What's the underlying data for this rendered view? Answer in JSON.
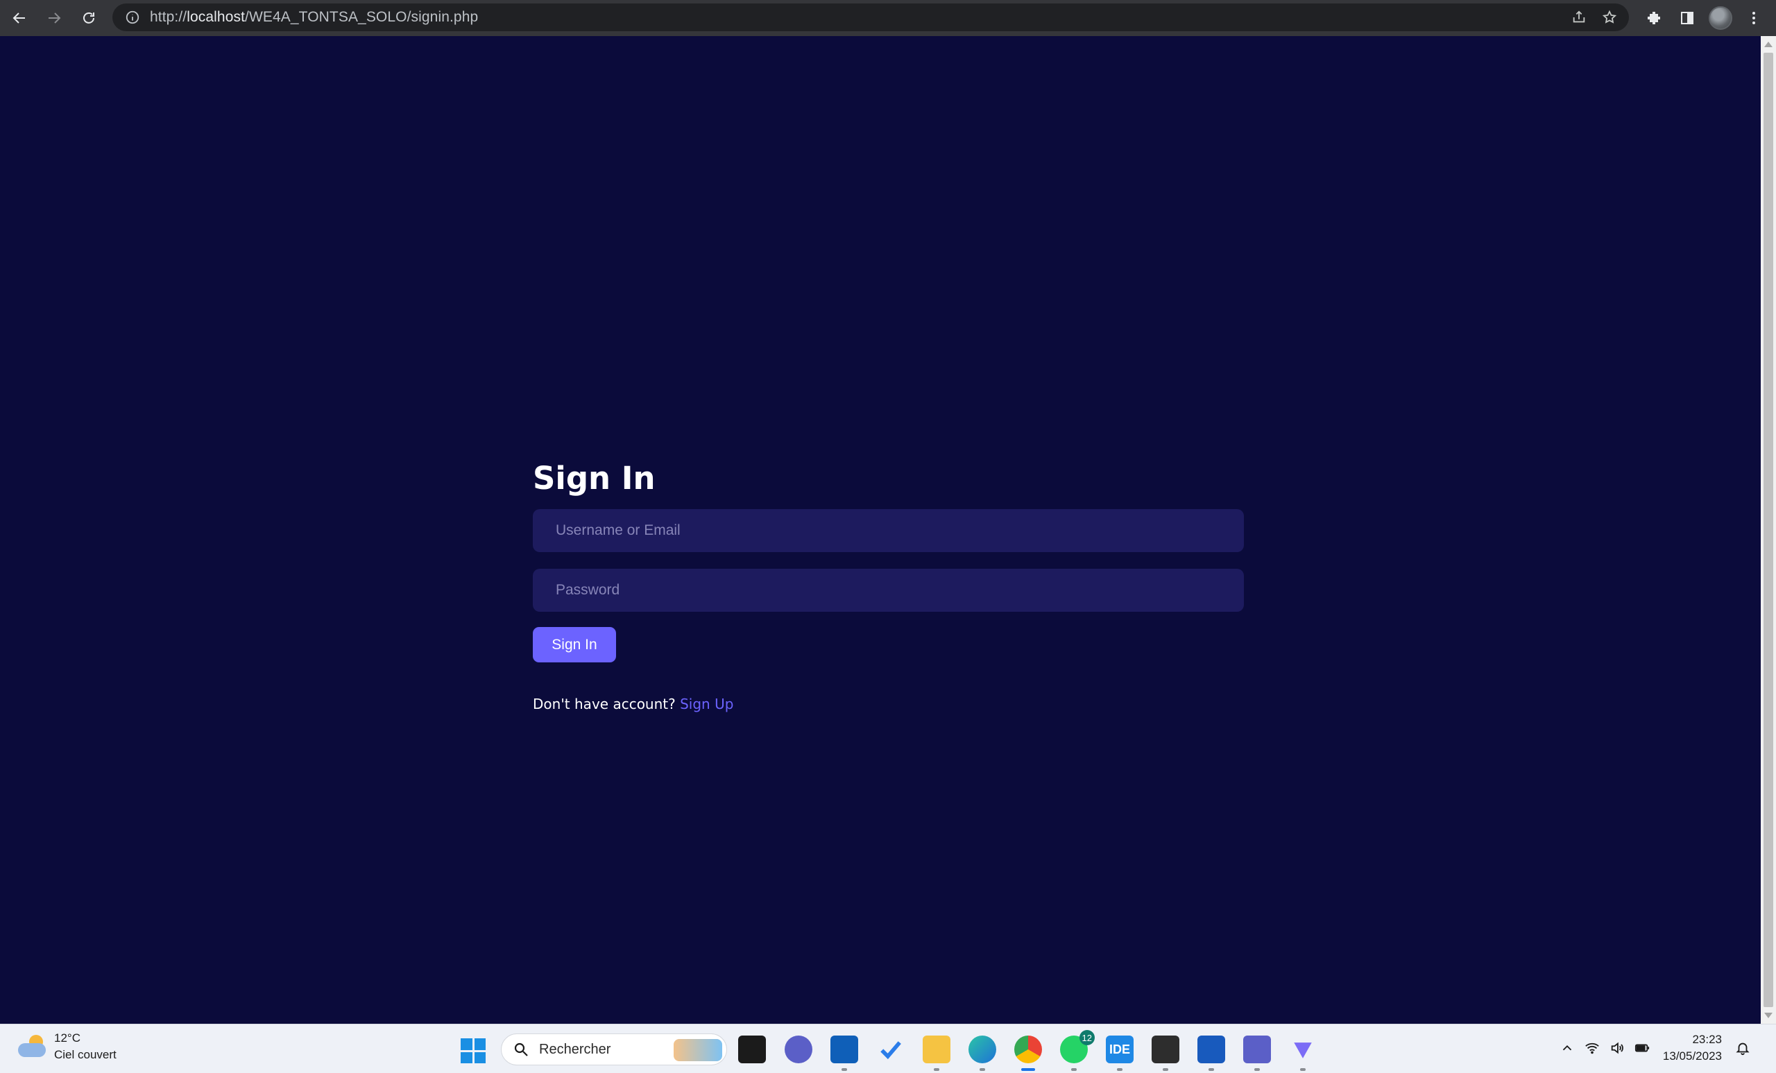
{
  "browser": {
    "url_scheme": "http://",
    "url_host": "localhost",
    "url_path": "/WE4A_TONTSA_SOLO/signin.php"
  },
  "form": {
    "title": "Sign In",
    "username_placeholder": "Username or Email",
    "password_placeholder": "Password",
    "submit_label": "Sign In",
    "no_account_text": "Don't have account?",
    "signup_link": "Sign Up"
  },
  "taskbar": {
    "weather_temp": "12°C",
    "weather_desc": "Ciel couvert",
    "search_placeholder": "Rechercher",
    "ide_label": "IDE",
    "whatsapp_badge": "12",
    "time": "23:23",
    "date": "13/05/2023",
    "apps": [
      "start-icon",
      "search-box",
      "task-view-icon",
      "chat-icon",
      "store-icon",
      "todo-icon",
      "file-explorer-icon",
      "edge-icon",
      "chrome-icon",
      "whatsapp-icon",
      "ide-icon",
      "terminal-icon",
      "word-icon",
      "teams-icon",
      "vpn-icon"
    ]
  },
  "colors": {
    "page_bg": "#0b0b3b",
    "input_bg": "#1d1b5e",
    "accent": "#6c63ff"
  }
}
